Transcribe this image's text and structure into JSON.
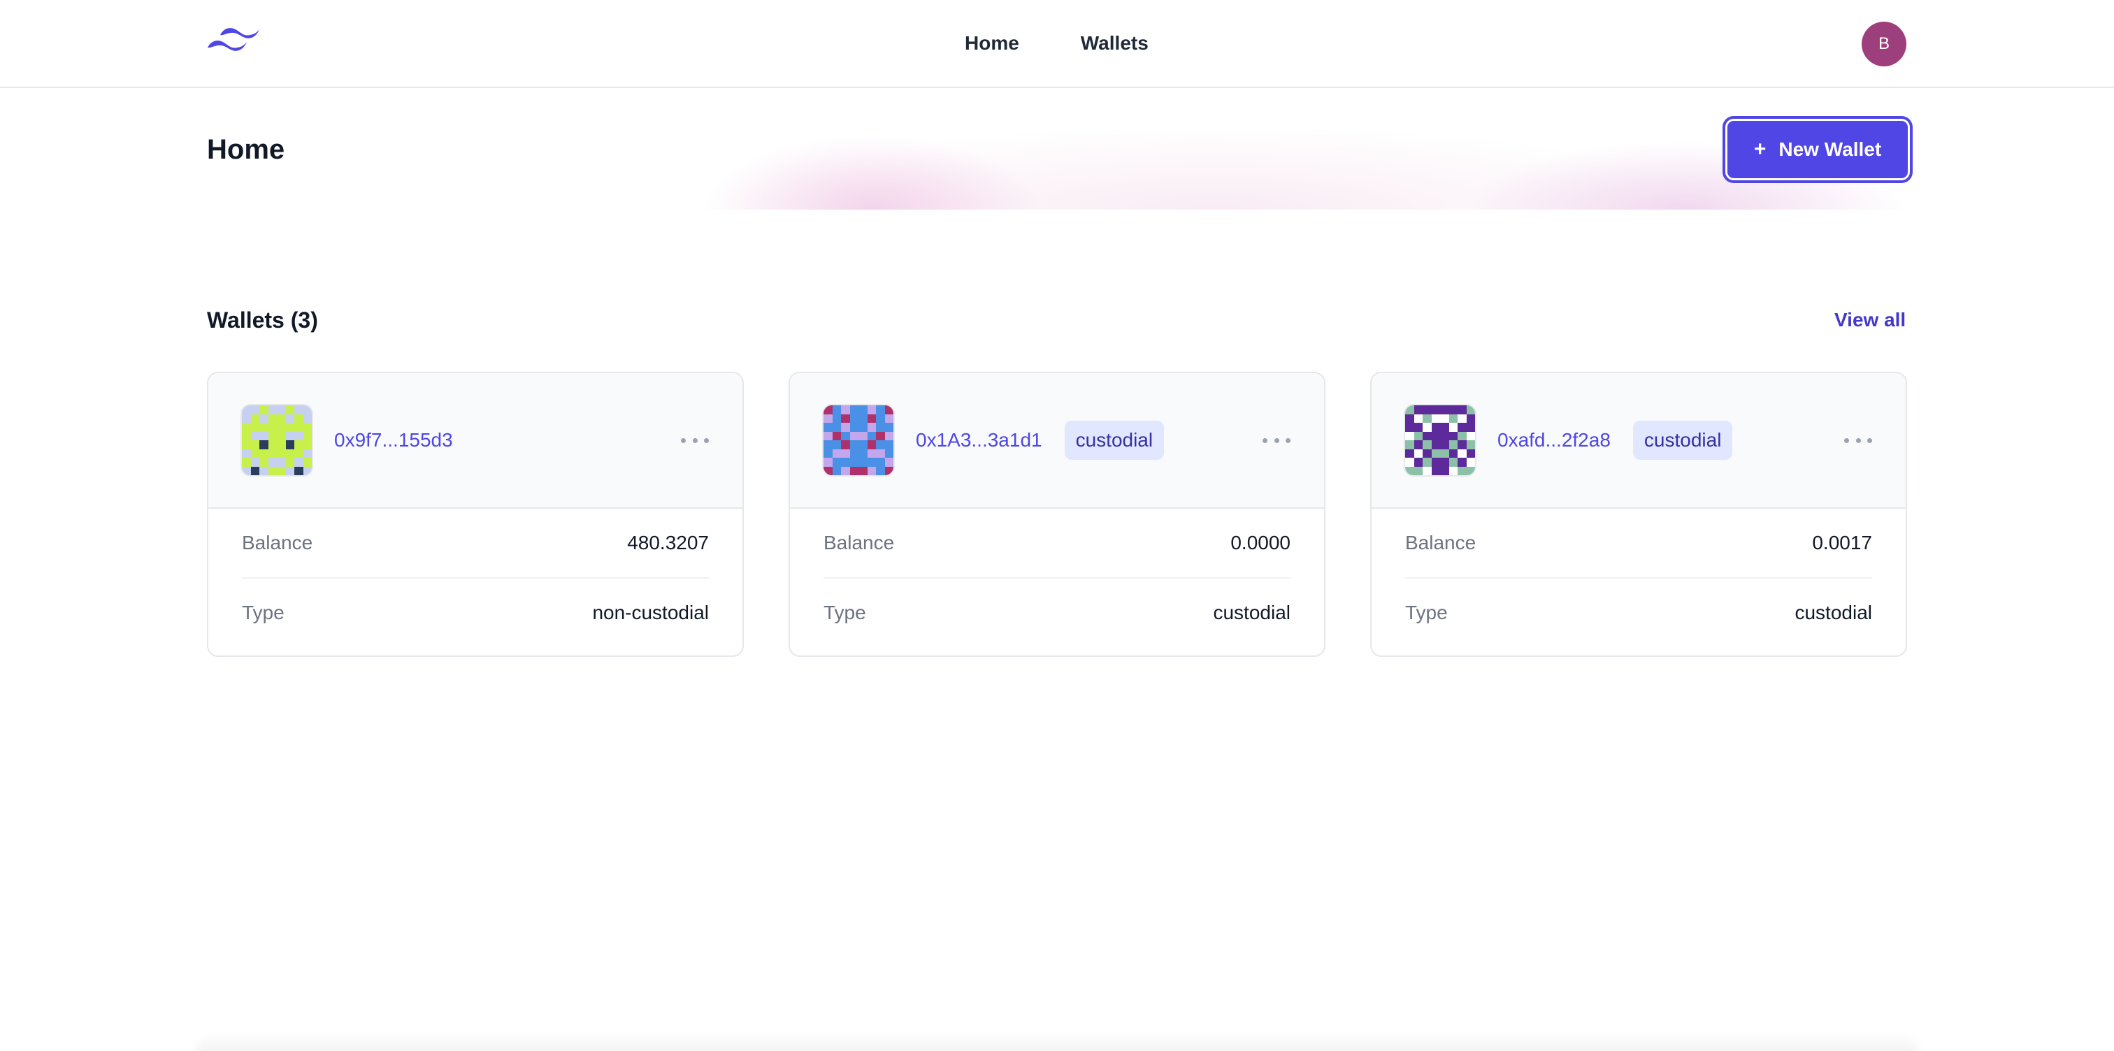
{
  "header": {
    "nav": [
      {
        "label": "Home"
      },
      {
        "label": "Wallets"
      }
    ],
    "avatar_initial": "B",
    "logo_icon": "tailwind-wave-logo"
  },
  "main": {
    "title": "Home",
    "new_wallet_button": {
      "icon": "plus-icon",
      "label": "New Wallet"
    }
  },
  "wallets": {
    "heading": "Wallets (3)",
    "view_all": "View all",
    "items": [
      {
        "address": "0x9f7...155d3",
        "badge": "",
        "balance_label": "Balance",
        "balance": "480.3207",
        "type_label": "Type",
        "type": "non-custodial",
        "identicon_colors": [
          "#c6d0f0",
          "#c8f04a",
          "#2a3d5a"
        ]
      },
      {
        "address": "0x1A3...3a1d1",
        "badge": "custodial",
        "balance_label": "Balance",
        "balance": "0.0000",
        "type_label": "Type",
        "type": "custodial",
        "identicon_colors": [
          "#c4a6ec",
          "#4a90e6",
          "#b0306a"
        ]
      },
      {
        "address": "0xafd...2f2a8",
        "badge": "custodial",
        "balance_label": "Balance",
        "balance": "0.0017",
        "type_label": "Type",
        "type": "custodial",
        "identicon_colors": [
          "#ffffff",
          "#5c2a9a",
          "#8cc0a8"
        ]
      }
    ]
  },
  "colors": {
    "accent": "#4f46e5",
    "badge_bg": "#e0e7ff",
    "avatar_bg": "#9d3f7d"
  }
}
